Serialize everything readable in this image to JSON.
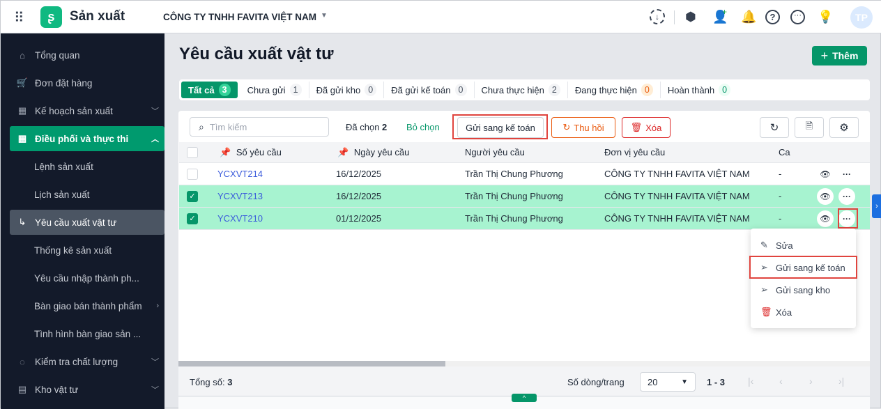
{
  "header": {
    "app_name": "Sản xuất",
    "company": "CÔNG TY TNHH FAVITA VIỆT NAM",
    "avatar": "TP"
  },
  "sidebar": {
    "items": [
      {
        "label": "Tổng quan",
        "icon": "home-icon"
      },
      {
        "label": "Đơn đặt hàng",
        "icon": "cart-icon"
      },
      {
        "label": "Kế hoạch sản xuất",
        "icon": "calendar-gear-icon"
      },
      {
        "label": "Điều phối và thực thi",
        "icon": "calendar-clock-icon"
      },
      {
        "label": "Lệnh sản xuất"
      },
      {
        "label": "Lịch sản xuất"
      },
      {
        "label": "Yêu cầu xuất vật tư"
      },
      {
        "label": "Thống kê sản xuất"
      },
      {
        "label": "Yêu cầu nhập thành ph..."
      },
      {
        "label": "Bàn giao bán thành phẩm"
      },
      {
        "label": "Tình hình bàn giao sản ..."
      },
      {
        "label": "Kiểm tra chất lượng",
        "icon": "check-circle-icon"
      },
      {
        "label": "Kho vật tư",
        "icon": "archive-icon"
      }
    ]
  },
  "page": {
    "title": "Yêu cầu xuất vật tư",
    "add_label": "Thêm"
  },
  "tabs": [
    {
      "label": "Tất cả",
      "count": "3"
    },
    {
      "label": "Chưa gửi",
      "count": "1"
    },
    {
      "label": "Đã gửi kho",
      "count": "0"
    },
    {
      "label": "Đã gửi kế toán",
      "count": "0"
    },
    {
      "label": "Chưa thực hiện",
      "count": "2"
    },
    {
      "label": "Đang thực hiện",
      "count": "0"
    },
    {
      "label": "Hoàn thành",
      "count": "0"
    }
  ],
  "toolbar": {
    "search_placeholder": "Tìm kiếm",
    "selected_label": "Đã chọn",
    "selected_count": "2",
    "deselect": "Bỏ chọn",
    "send_accounting": "Gửi sang kế toán",
    "recall": "Thu hồi",
    "delete": "Xóa"
  },
  "table": {
    "columns": [
      "Số yêu cầu",
      "Ngày yêu cầu",
      "Người yêu cầu",
      "Đơn vị yêu cầu",
      "Ca sả"
    ],
    "rows": [
      {
        "code": "YCXVT214",
        "date": "16/12/2025",
        "requester": "Trần Thị Chung Phương",
        "unit": "CÔNG TY TNHH FAVITA VIỆT NAM",
        "shift": "-",
        "selected": false
      },
      {
        "code": "YCXVT213",
        "date": "16/12/2025",
        "requester": "Trần Thị Chung Phương",
        "unit": "CÔNG TY TNHH FAVITA VIỆT NAM",
        "shift": "-",
        "selected": true
      },
      {
        "code": "YCXVT210",
        "date": "01/12/2025",
        "requester": "Trần Thị Chung Phương",
        "unit": "CÔNG TY TNHH FAVITA VIỆT NAM",
        "shift": "-",
        "selected": true
      }
    ]
  },
  "menu": {
    "items": [
      "Sửa",
      "Gửi sang kế toán",
      "Gửi sang kho",
      "Xóa"
    ]
  },
  "footer": {
    "total_label": "Tổng số:",
    "total": "3",
    "rows_per_page_label": "Số dòng/trang",
    "rows_per_page": "20",
    "range": "1 - 3"
  }
}
